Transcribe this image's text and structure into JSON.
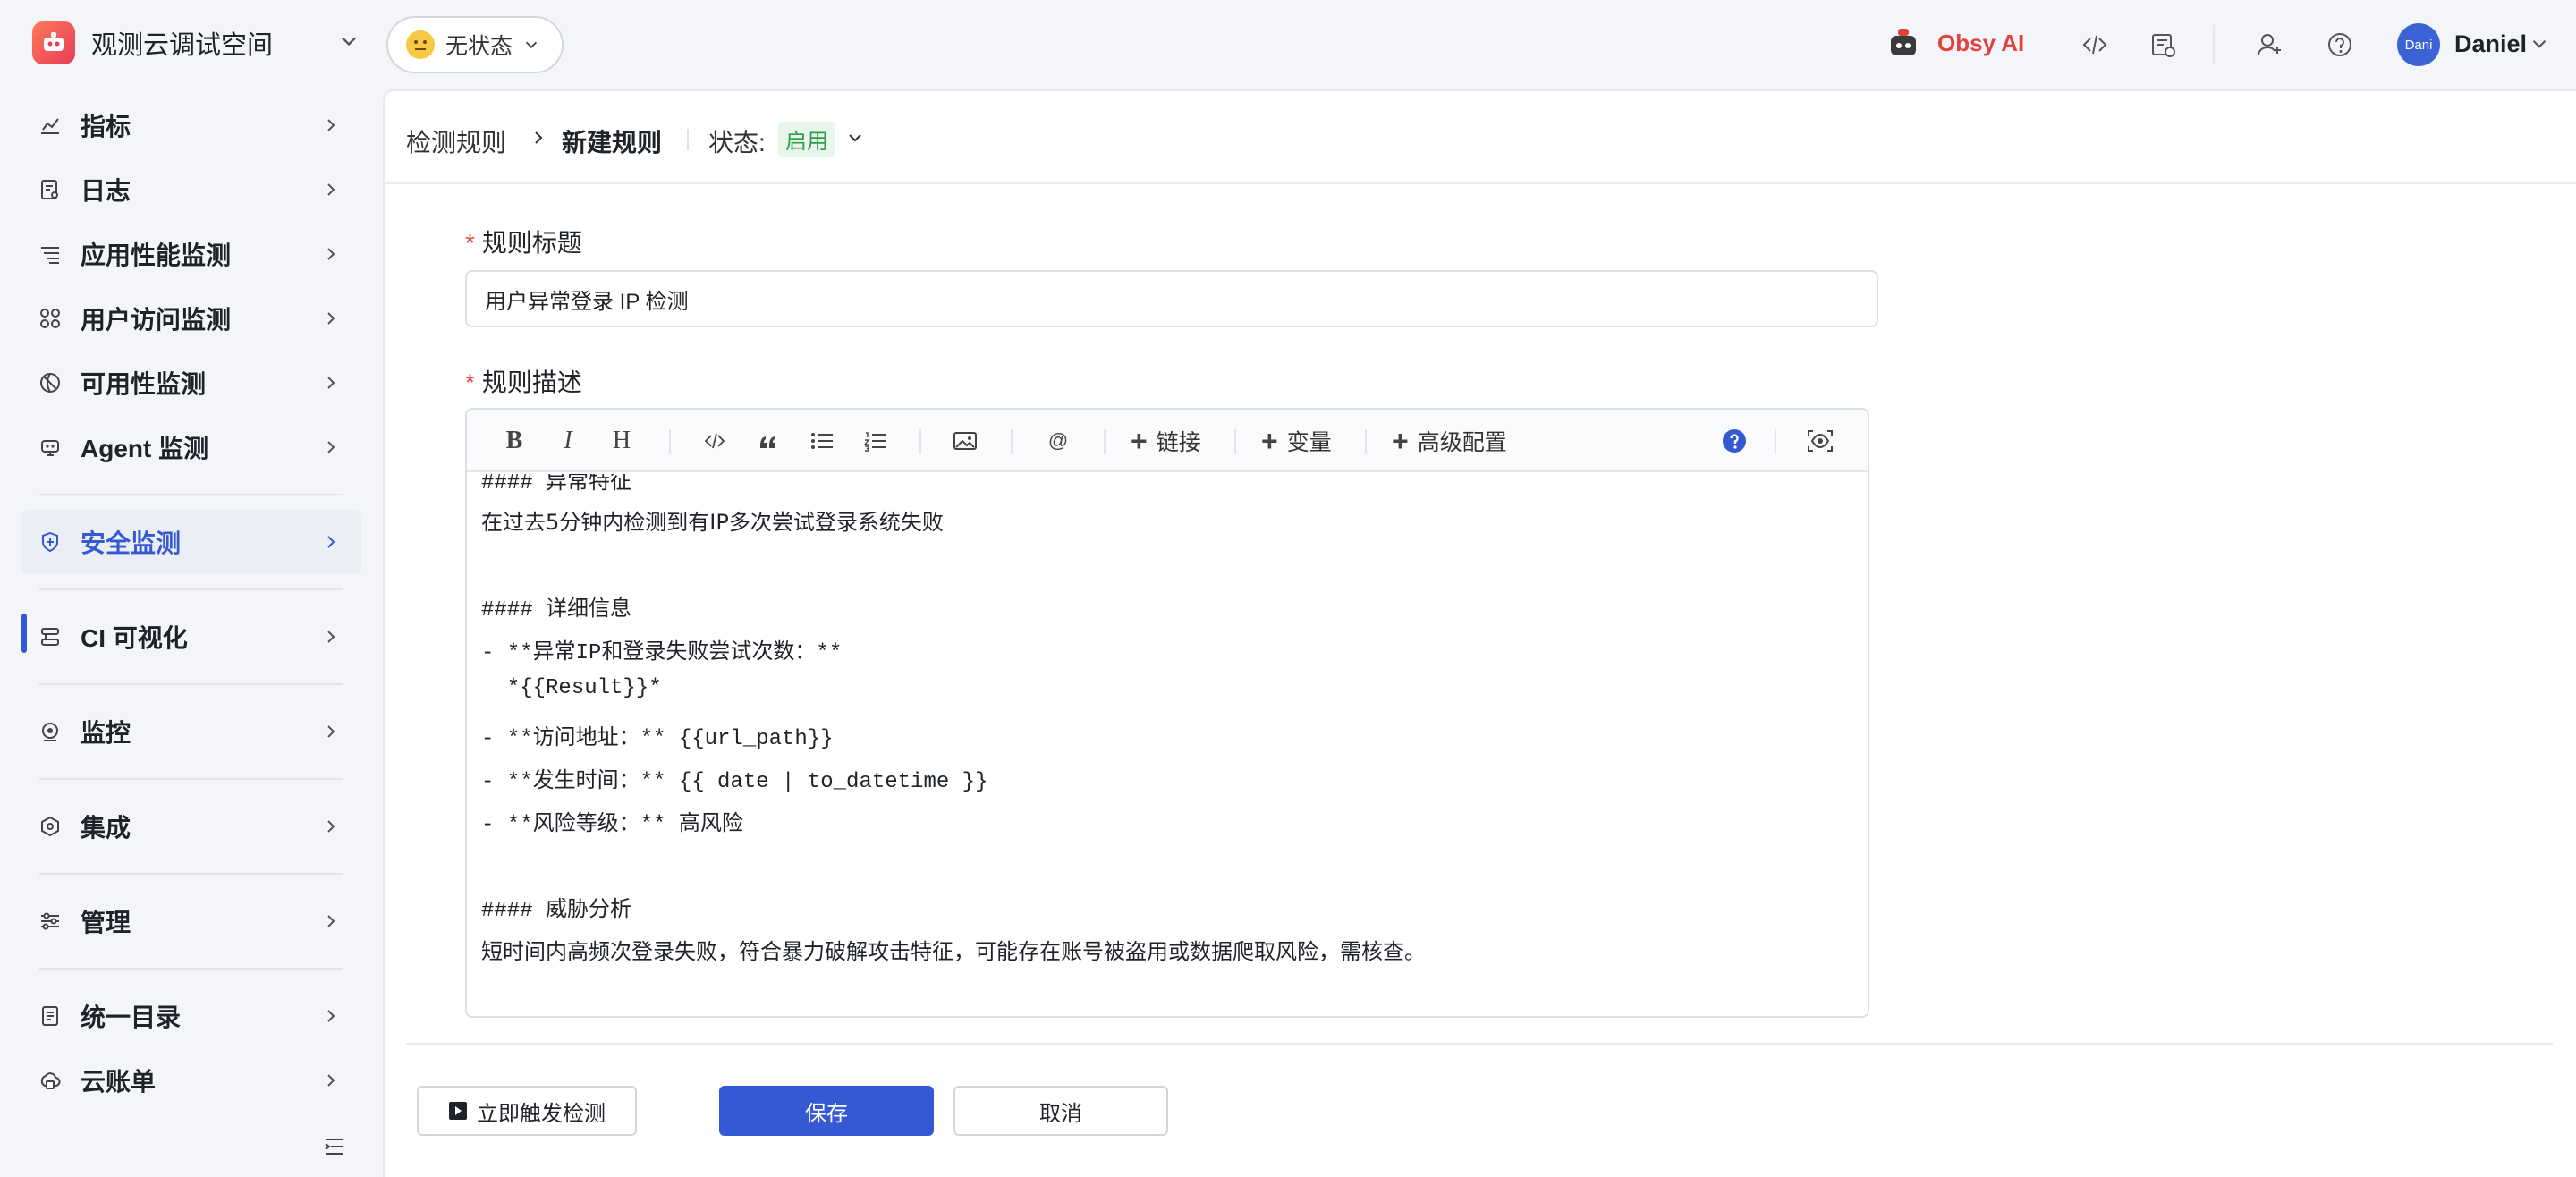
{
  "workspace": {
    "name": "观测云调试空间"
  },
  "status": {
    "label": "无状态"
  },
  "topbar": {
    "ai_label": "Obsy AI",
    "avatar_text": "Dani",
    "user_name": "Daniel"
  },
  "sidebar": {
    "items": [
      {
        "label": "指标",
        "icon": "chart-icon"
      },
      {
        "label": "日志",
        "icon": "log-icon"
      },
      {
        "label": "应用性能监测",
        "icon": "apm-icon"
      },
      {
        "label": "用户访问监测",
        "icon": "rum-icon"
      },
      {
        "label": "可用性监测",
        "icon": "dialtest-icon"
      },
      {
        "label": "Agent 监测",
        "icon": "agent-icon"
      },
      {
        "label": "安全监测",
        "icon": "shield-icon",
        "active": true
      },
      {
        "label": "CI 可视化",
        "icon": "ci-icon"
      },
      {
        "label": "监控",
        "icon": "monitor-icon"
      },
      {
        "label": "集成",
        "icon": "integration-icon"
      },
      {
        "label": "管理",
        "icon": "settings-sliders-icon"
      },
      {
        "label": "统一目录",
        "icon": "catalog-icon"
      },
      {
        "label": "云账单",
        "icon": "billing-icon"
      }
    ],
    "accent_color": "#3559d2"
  },
  "header": {
    "breadcrumb_parent": "检测规则",
    "breadcrumb_current": "新建规则",
    "state_label": "状态:",
    "state_value": "启用"
  },
  "form": {
    "title_label": "规则标题",
    "title_value": "用户异常登录 IP 检测",
    "desc_label": "规则描述",
    "toolbar": {
      "bold": "B",
      "italic": "I",
      "heading": "H",
      "mention": "@",
      "link": "链接",
      "variable": "变量",
      "advanced": "高级配置"
    },
    "desc_lines": [
      "#### 异常特征",
      "在过去5分钟内检测到有IP多次尝试登录系统失败",
      "",
      "#### 详细信息",
      "- **异常IP和登录失败尝试次数：**",
      "  *{{Result}}*",
      "- **访问地址：** {{url_path}}",
      "- **发生时间：** {{ date | to_datetime }}",
      "- **风险等级：** 高风险",
      "",
      "#### 威胁分析",
      "短时间内高频次登录失败，符合暴力破解攻击特征，可能存在账号被盗用或数据爬取风险，需核查。"
    ]
  },
  "footer": {
    "trigger_label": "立即触发检测",
    "save_label": "保存",
    "cancel_label": "取消"
  }
}
